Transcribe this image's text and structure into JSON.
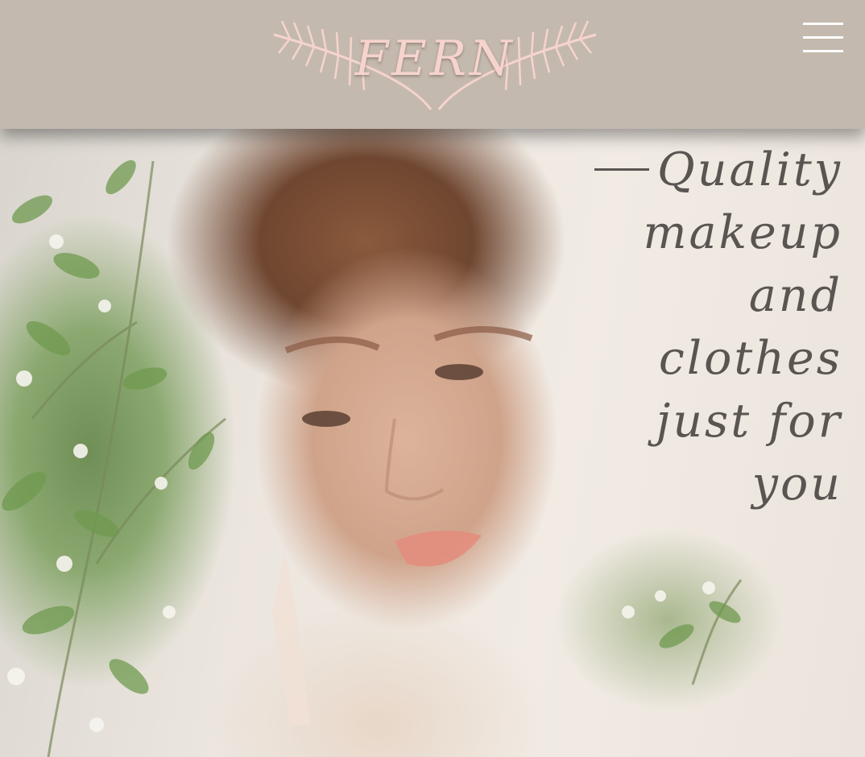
{
  "header": {
    "brand": "FERN",
    "menu_icon": "hamburger-menu-icon"
  },
  "hero": {
    "tagline_lines": [
      "Quality",
      "makeup",
      "and",
      "clothes",
      "just for",
      "you"
    ]
  },
  "colors": {
    "header_bg": "#c4b9ae",
    "logo_pink": "#f6d4cd",
    "tagline_text": "#5b5552"
  }
}
